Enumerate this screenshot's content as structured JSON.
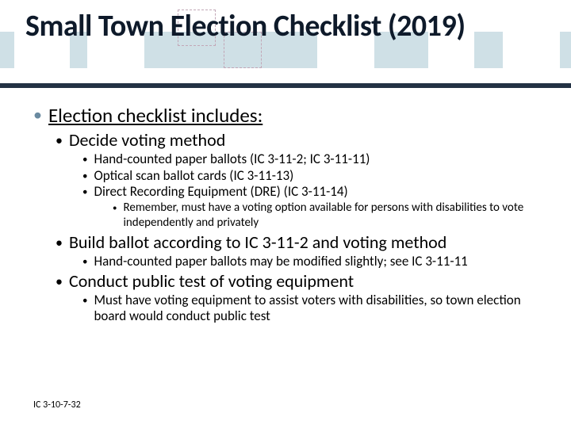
{
  "title": "Small Town Election Checklist (2019)",
  "heading": "Election checklist includes:",
  "items": {
    "decide": {
      "label": "Decide voting method",
      "sub1": "Hand-counted paper ballots (IC 3-11-2; IC 3-11-11)",
      "sub2": "Optical scan ballot cards (IC 3-11-13)",
      "sub3": "Direct Recording Equipment (DRE) (IC 3-11-14)",
      "note": "Remember, must have a voting option available for persons with disabilities to vote independently and privately"
    },
    "build": {
      "label": "Build ballot according to IC 3-11-2 and voting method",
      "sub1": "Hand-counted paper ballots may be modified slightly; see IC 3-11-11"
    },
    "conduct": {
      "label": "Conduct public test of voting equipment",
      "sub1": "Must have voting equipment to assist voters with disabilities, so town election board would conduct public test"
    }
  },
  "footer_ref": "IC 3-10-7-32"
}
